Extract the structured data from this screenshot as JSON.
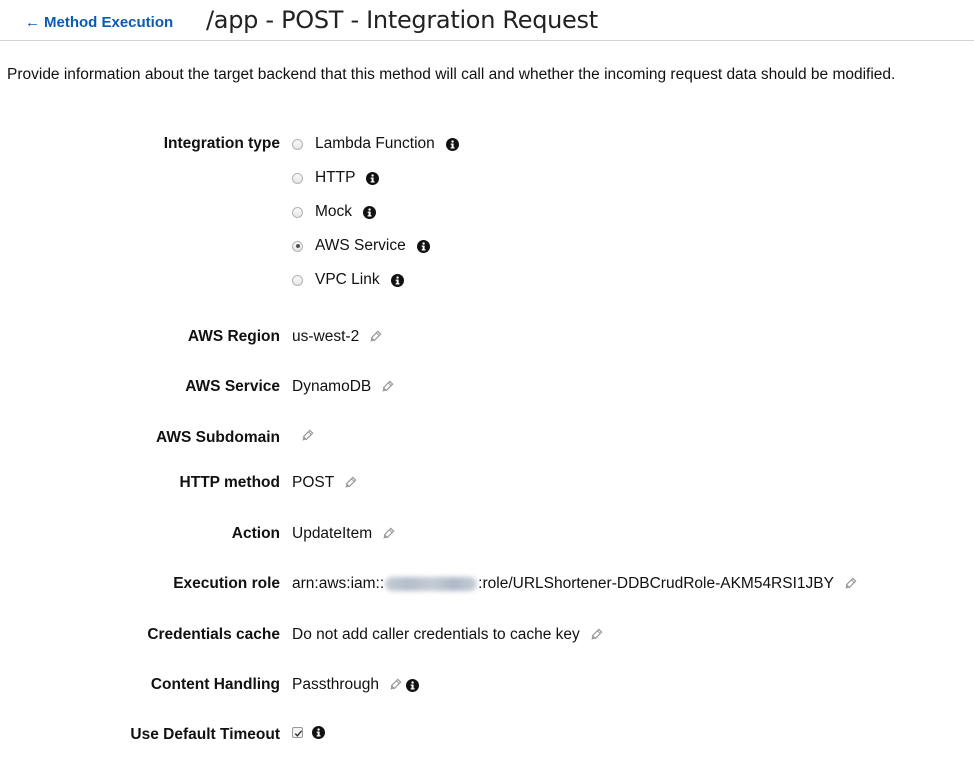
{
  "header": {
    "back_label": "Method Execution",
    "title": "/app - POST - Integration Request"
  },
  "description": "Provide information about the target backend that this method will call and whether the incoming request data should be modified.",
  "integration_type": {
    "label": "Integration type",
    "options": [
      {
        "label": "Lambda Function",
        "selected": false
      },
      {
        "label": "HTTP",
        "selected": false
      },
      {
        "label": "Mock",
        "selected": false
      },
      {
        "label": "AWS Service",
        "selected": true
      },
      {
        "label": "VPC Link",
        "selected": false
      }
    ]
  },
  "fields": {
    "aws_region": {
      "label": "AWS Region",
      "value": "us-west-2"
    },
    "aws_service": {
      "label": "AWS Service",
      "value": "DynamoDB"
    },
    "aws_subdomain": {
      "label": "AWS Subdomain",
      "value": ""
    },
    "http_method": {
      "label": "HTTP method",
      "value": "POST"
    },
    "action": {
      "label": "Action",
      "value": "UpdateItem"
    },
    "execution_role": {
      "label": "Execution role",
      "value_prefix": "arn:aws:iam::",
      "value_suffix": ":role/URLShortener-DDBCrudRole-AKM54RSI1JBY"
    },
    "credentials_cache": {
      "label": "Credentials cache",
      "value": "Do not add caller credentials to cache key"
    },
    "content_handling": {
      "label": "Content Handling",
      "value": "Passthrough"
    },
    "use_default_timeout": {
      "label": "Use Default Timeout",
      "checked": true
    }
  },
  "icons": {
    "info": "info-icon",
    "edit": "pencil-icon",
    "back": "arrow-left-icon"
  },
  "colors": {
    "link": "#0a5bb3",
    "pencil": "#9a9a9a"
  }
}
